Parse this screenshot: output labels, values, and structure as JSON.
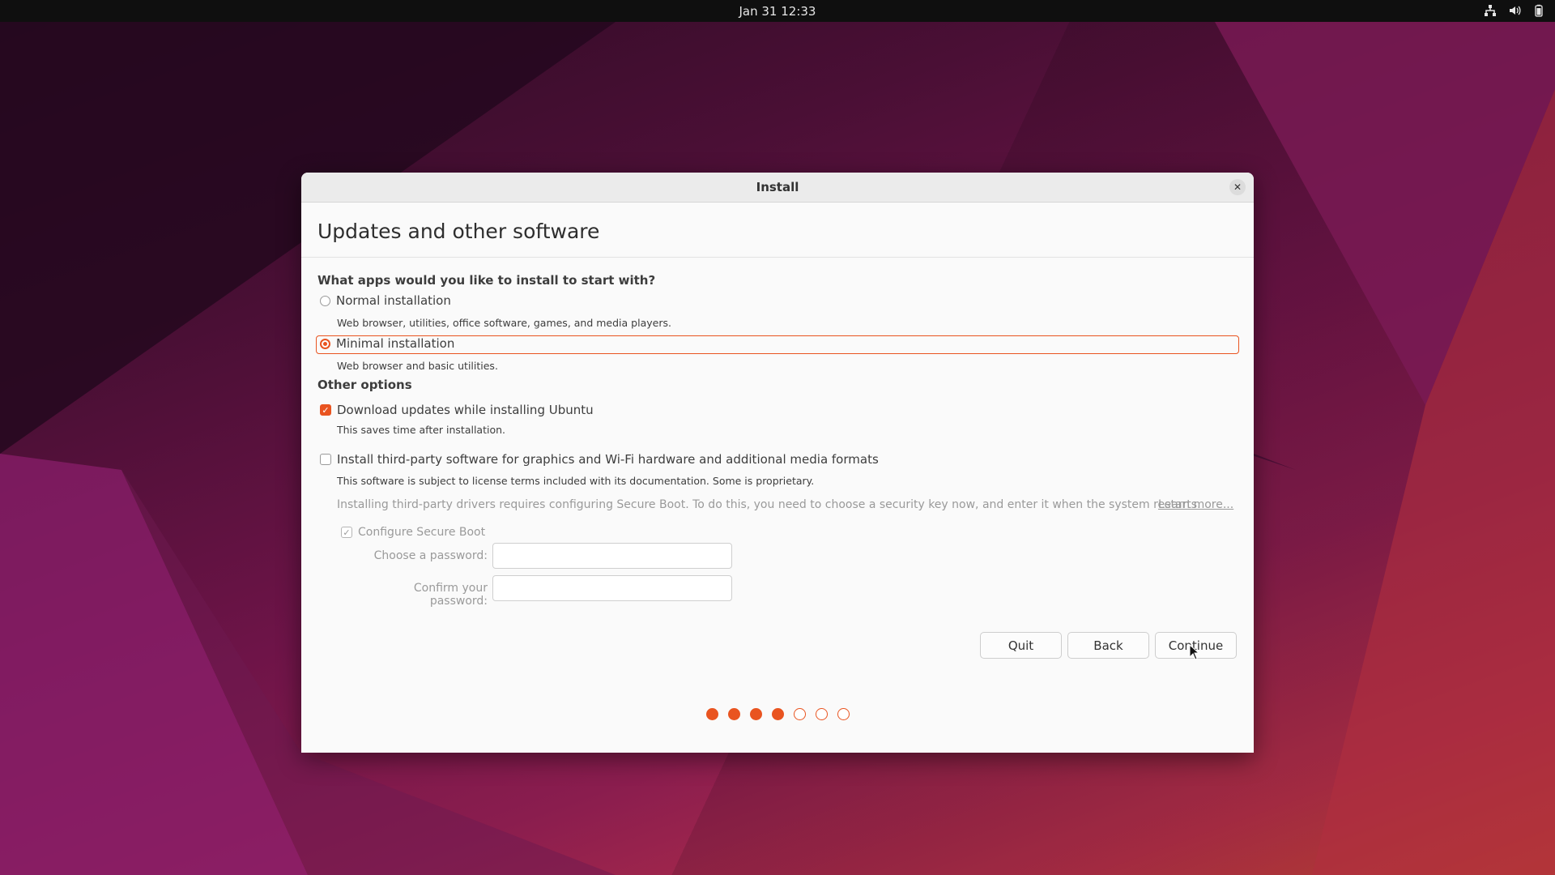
{
  "topbar": {
    "datetime": "Jan 31  12:33",
    "tray_icons": [
      "network-icon",
      "volume-icon",
      "battery-icon"
    ]
  },
  "dialog": {
    "window_title": "Install",
    "page_title": "Updates and other software",
    "question": "What apps would you like to install to start with?",
    "install_options": [
      {
        "label": "Normal installation",
        "description": "Web browser, utilities, office software, games, and media players.",
        "selected": false
      },
      {
        "label": "Minimal installation",
        "description": "Web browser and basic utilities.",
        "selected": true
      }
    ],
    "other_options_heading": "Other options",
    "download_updates": {
      "label": "Download updates while installing Ubuntu",
      "description": "This saves time after installation.",
      "checked": true
    },
    "third_party": {
      "label": "Install third-party software for graphics and Wi-Fi hardware and additional media formats",
      "description": "This software is subject to license terms included with its documentation. Some is proprietary.",
      "checked": false
    },
    "secure_boot_note": "Installing third-party drivers requires configuring Secure Boot. To do this, you need to choose a security key now, and enter it when the system restarts.",
    "learn_more": "Learn more...",
    "configure_secure_boot": {
      "label": "Configure Secure Boot",
      "checked": true,
      "enabled": false
    },
    "password_label": "Choose a password:",
    "password_value": "",
    "confirm_label": "Confirm your password:",
    "confirm_value": "",
    "buttons": {
      "quit": "Quit",
      "back": "Back",
      "continue": "Continue"
    },
    "progress": {
      "completed_steps": 4,
      "total_steps": 7
    }
  },
  "colors": {
    "accent": "#e95420",
    "topbar": "#0f0f0f",
    "dialog_bg": "#fafafa"
  }
}
